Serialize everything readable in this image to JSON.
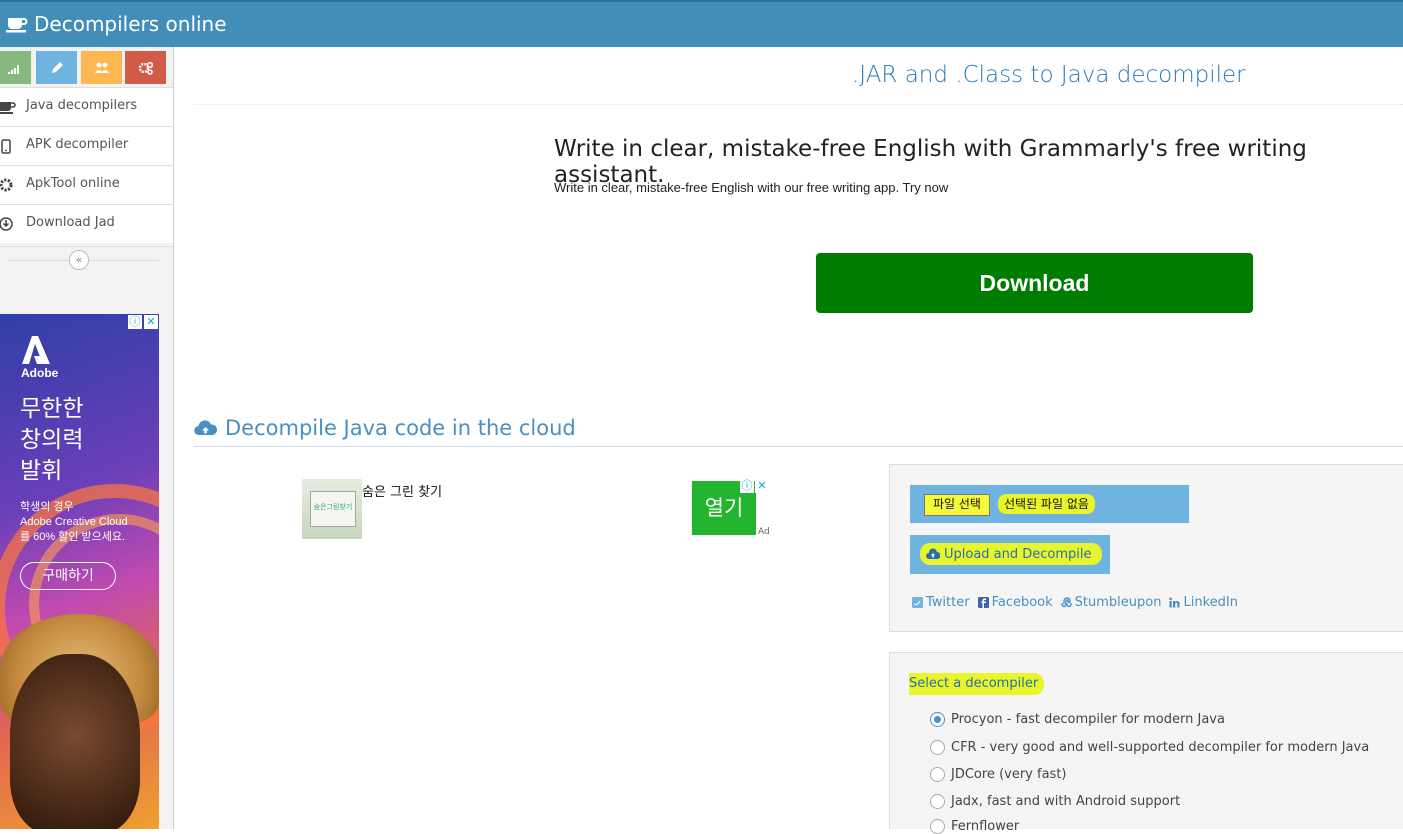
{
  "app": {
    "title": "Decompilers online"
  },
  "sidebar": {
    "shortcuts": [
      {
        "name": "signal-icon",
        "color": "#87b87f"
      },
      {
        "name": "pencil-icon",
        "color": "#6fb3e0"
      },
      {
        "name": "users-icon",
        "color": "#ffb752"
      },
      {
        "name": "cogs-icon",
        "color": "#d15b47"
      }
    ],
    "items": [
      {
        "label": "Java decompilers",
        "icon": "coffee-icon"
      },
      {
        "label": "APK decompiler",
        "icon": "mobile-icon"
      },
      {
        "label": "ApkTool online",
        "icon": "cog-icon"
      },
      {
        "label": "Download Jad",
        "icon": "download-icon"
      }
    ],
    "collapse_glyph": "«"
  },
  "ad_left": {
    "brand": "Adobe",
    "headline_lines": [
      "무한한",
      "창의력",
      "발휘"
    ],
    "sub_lines": [
      "학생의 경우",
      "Adobe Creative Cloud",
      "를 60% 할인 받으세요."
    ],
    "cta": "구매하기",
    "info_glyph": "ⓘ",
    "close_glyph": "✕"
  },
  "main": {
    "title": ".JAR and .Class to Java decompiler",
    "grammarly": {
      "headline": "Write in clear, mistake-free English with Grammarly's free writing assistant.",
      "sub": "Write in clear, mistake-free English with our free writing app. Try now",
      "button": "Download"
    },
    "section_title": "Decompile Java code in the cloud",
    "ad_mid": {
      "thumb_text": "숨은그림찾기",
      "text": "숨은 그린 찾기",
      "open_button": "열기",
      "info_glyph": "ⓘ",
      "close_glyph": "✕",
      "ad_tag": "Ad"
    },
    "upload": {
      "choose_file": "파일 선택",
      "no_file": "선택된 파일 없음",
      "upload_button": "Upload and Decompile"
    },
    "share": [
      {
        "label": "Twitter",
        "icon": "twitter-icon"
      },
      {
        "label": "Facebook",
        "icon": "facebook-icon"
      },
      {
        "label": "Stumbleupon",
        "icon": "stumbleupon-icon"
      },
      {
        "label": "LinkedIn",
        "icon": "linkedin-icon"
      }
    ],
    "decompiler": {
      "title": "Select a decompiler",
      "selected_index": 0,
      "options": [
        "Procyon - fast decompiler for modern Java",
        "CFR - very good and well-supported decompiler for modern Java",
        "JDCore (very fast)",
        "Jadx, fast and with Android support",
        "Fernflower"
      ]
    }
  },
  "colors": {
    "topbar": "#438eb9",
    "download": "#007c00",
    "highlight": "#e8f52a",
    "link": "#4a8fc2"
  }
}
